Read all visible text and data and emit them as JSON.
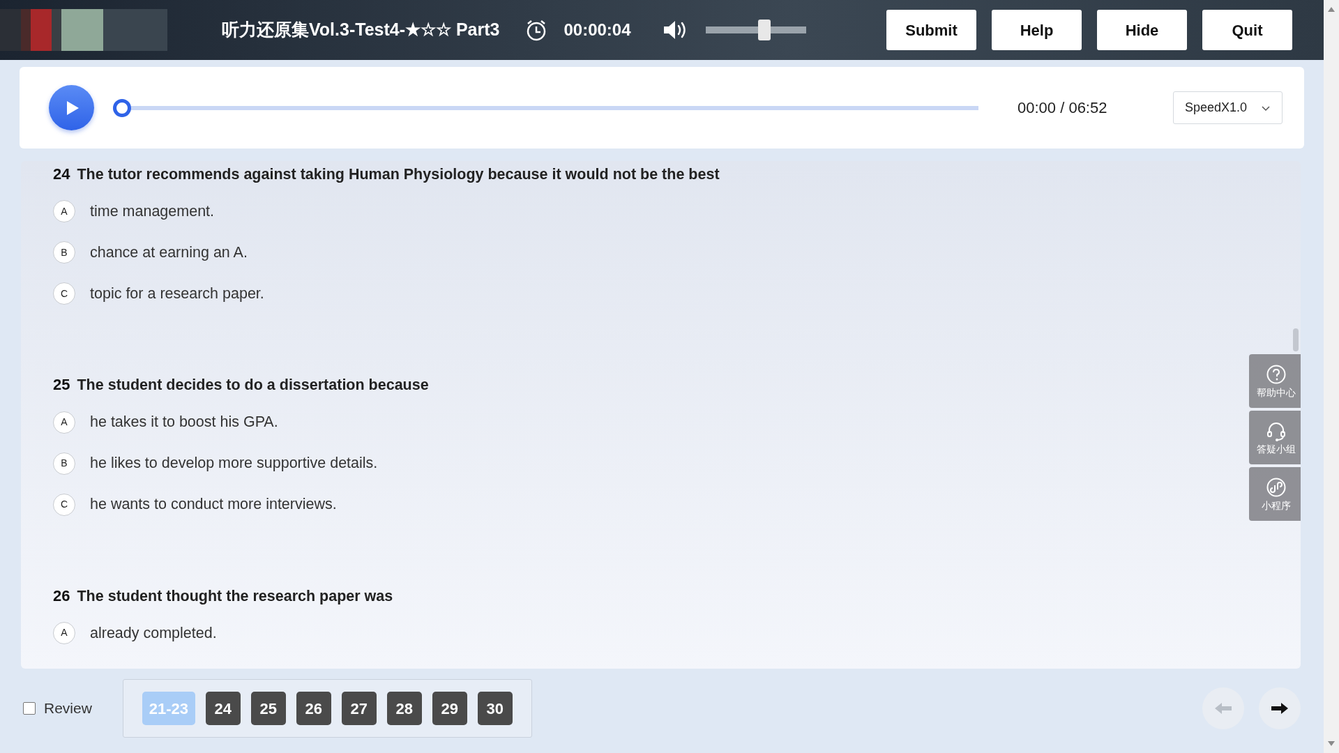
{
  "header": {
    "title": "听力还原集Vol.3-Test4-★☆☆ Part3",
    "timer": "00:00:04",
    "volume": {
      "level": 0.6
    },
    "buttons": [
      "Submit",
      "Help",
      "Hide",
      "Quit"
    ]
  },
  "player": {
    "playing": false,
    "progress": {
      "level": 0
    },
    "time": "00:00 / 06:52",
    "speed": "SpeedX1.0"
  },
  "questions": [
    {
      "number": "24",
      "text": "The tutor recommends against taking Human Physiology because it would not be the best",
      "options": [
        {
          "letter": "A",
          "text": "time management."
        },
        {
          "letter": "B",
          "text": "chance at earning an A."
        },
        {
          "letter": "C",
          "text": "topic for a research paper."
        }
      ]
    },
    {
      "number": "25",
      "text": "The student decides to do a dissertation because",
      "options": [
        {
          "letter": "A",
          "text": "he takes it to boost his GPA."
        },
        {
          "letter": "B",
          "text": "he likes to develop more supportive details."
        },
        {
          "letter": "C",
          "text": "he wants to conduct more interviews."
        }
      ]
    },
    {
      "number": "26",
      "text": "The student thought the research paper was",
      "options": [
        {
          "letter": "A",
          "text": "already completed."
        }
      ]
    }
  ],
  "side_tools": [
    {
      "kind": "help",
      "label": "帮助中心"
    },
    {
      "kind": "headset",
      "label": "答疑小组"
    },
    {
      "kind": "link",
      "label": "小程序"
    }
  ],
  "footer": {
    "review": {
      "label": "Review",
      "checked": false
    },
    "pages": [
      {
        "label": "21-23",
        "selected": true
      },
      {
        "label": "24",
        "selected": false
      },
      {
        "label": "25",
        "selected": false
      },
      {
        "label": "26",
        "selected": false
      },
      {
        "label": "27",
        "selected": false
      },
      {
        "label": "28",
        "selected": false
      },
      {
        "label": "29",
        "selected": false
      },
      {
        "label": "30",
        "selected": false
      }
    ],
    "prev": {
      "disabled": true
    },
    "next": {
      "disabled": false
    }
  }
}
